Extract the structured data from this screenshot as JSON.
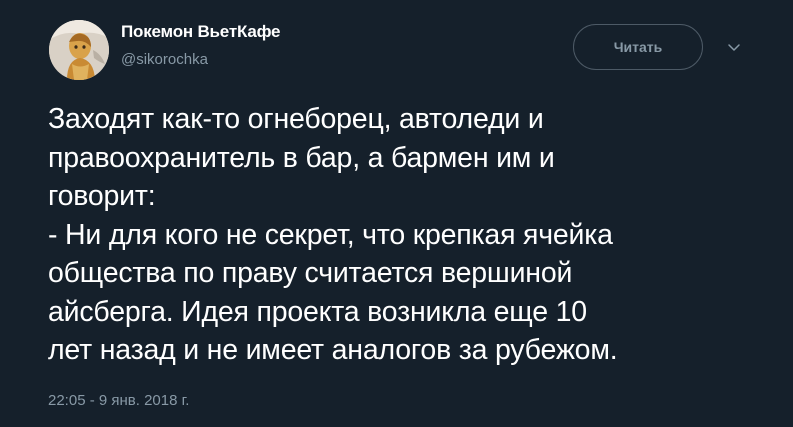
{
  "tweet": {
    "display_name": "Покемон ВьетКафе",
    "username": "@sikorochka",
    "follow_label": "Читать",
    "caret_icon": "chevron-down-icon",
    "avatar_icon": "user-avatar",
    "text": "Заходят как-то огнеборец, автоледи и\nправоохранитель в бар, а бармен им и\nговорит:\n- Ни для кого не секрет, что крепкая ячейка\nобщества по праву считается вершиной\nайсберга. Идея проекта возникла еще 10\nлет назад и не имеет аналогов за рубежом.",
    "timestamp": "22:05 - 9 янв. 2018 г."
  },
  "colors": {
    "background": "#15202b",
    "text": "#ffffff",
    "muted": "#8899a6",
    "border": "#4d5a66"
  }
}
